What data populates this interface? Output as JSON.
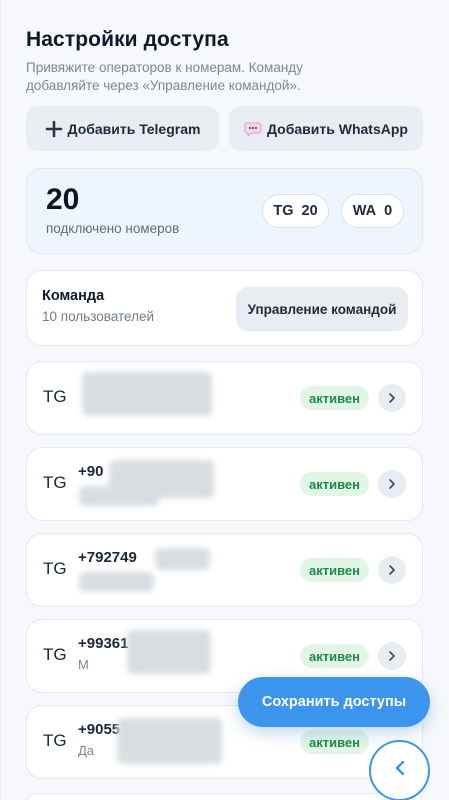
{
  "header": {
    "title": "Настройки доступа",
    "subtitle": "Привяжите операторов к номерам. Команду добавляйте через «Управление командой»."
  },
  "actions": {
    "add_telegram": "Добавить Telegram",
    "add_whatsapp": "Добавить WhatsApp"
  },
  "stats": {
    "count": "20",
    "label": "подключено номеров",
    "tg_label": "TG",
    "tg_count": "20",
    "wa_label": "WA",
    "wa_count": "0"
  },
  "team": {
    "title": "Команда",
    "count": "10 пользователей",
    "manage_label": "Управление командой"
  },
  "numbers": [
    {
      "type": "TG",
      "phone": "",
      "name": "",
      "status": "активен"
    },
    {
      "type": "TG",
      "phone": "+90",
      "name": "",
      "status": "активен"
    },
    {
      "type": "TG",
      "phone": "+792749",
      "name": "",
      "status": "активен"
    },
    {
      "type": "TG",
      "phone": "+99361",
      "name": "М",
      "status": "активен"
    },
    {
      "type": "TG",
      "phone": "+9055",
      "name": "Да",
      "status": "активен"
    }
  ],
  "footer": {
    "save_label": "Сохранить доступы"
  },
  "icons": {
    "add": "plus-icon",
    "whatsapp": "chat-bubble-icon",
    "chevron": "chevron-right-icon",
    "back": "chevron-left-icon"
  },
  "colors": {
    "accent": "#3b95ec",
    "active_bg": "#e2f6e8",
    "active_text": "#1f8a47"
  }
}
